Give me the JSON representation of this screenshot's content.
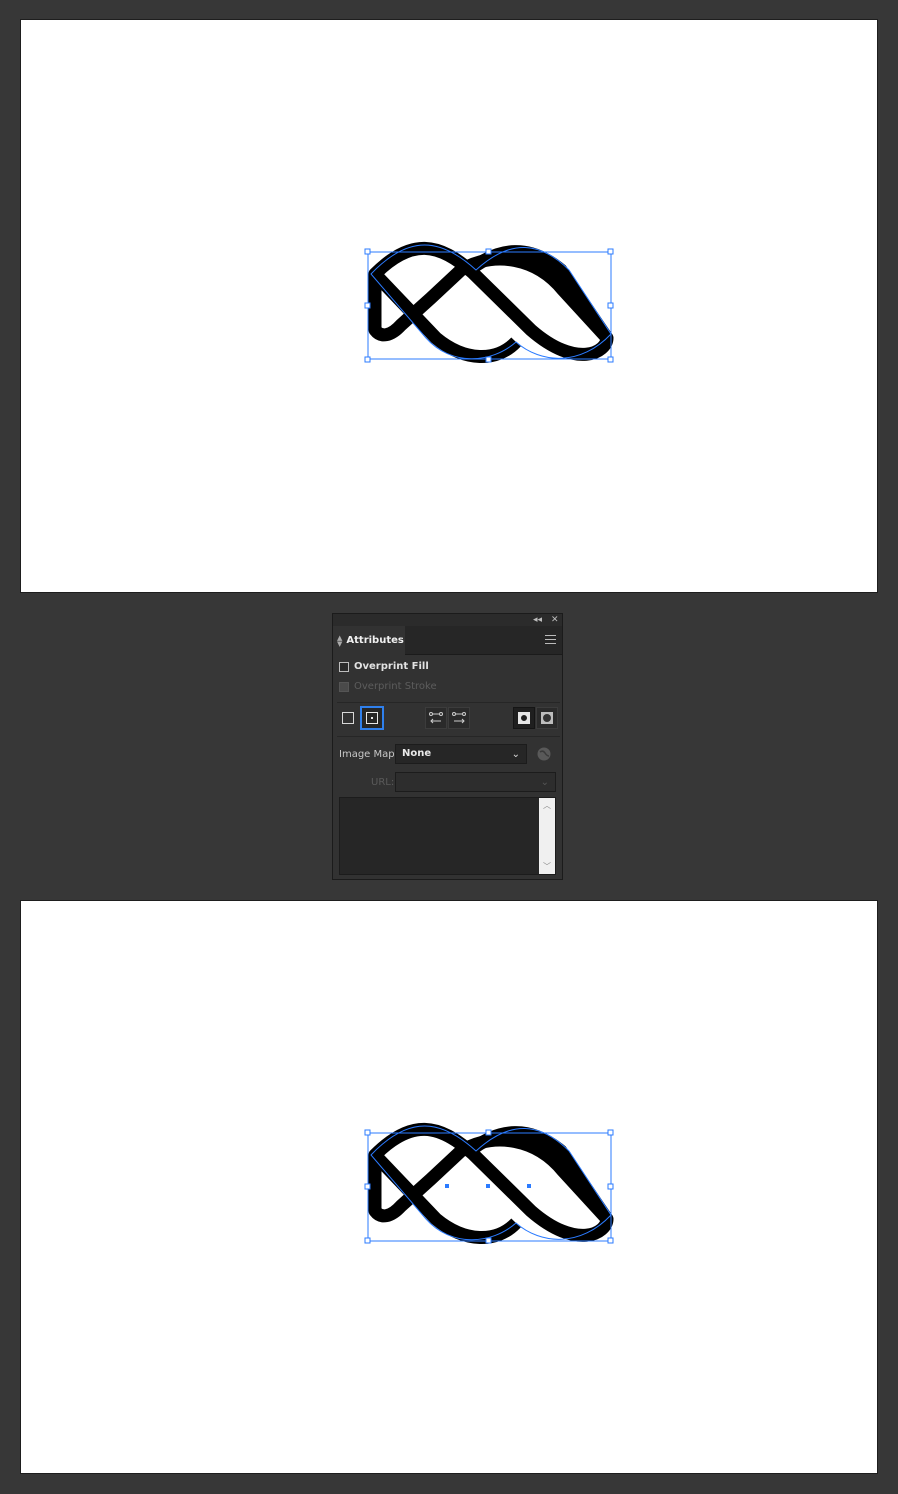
{
  "panel": {
    "tab_label": "Attributes",
    "collapse_glyph": "◂◂",
    "close_glyph": "✕",
    "overprint_fill_label": "Overprint Fill",
    "overprint_stroke_label": "Overprint Stroke",
    "overprint_fill_checked": false,
    "overprint_stroke_checked": false,
    "image_map_label": "Image Map:",
    "image_map_value": "None",
    "url_label": "URL:",
    "url_value": "",
    "chevron": "⌄",
    "scroll_up": "︿",
    "scroll_down": "﹀"
  },
  "icons": {
    "dont-show-center": "square-icon",
    "show-center": "square-dot-icon",
    "reverse-path-left": "reverse-path-left-icon",
    "reverse-path-right": "reverse-path-right-icon",
    "nonzero-winding": "nonzero-winding-icon",
    "even-odd": "even-odd-icon",
    "globe": "globe-icon"
  },
  "colors": {
    "selection": "#2b7bff",
    "accent_border": "#2f80ed",
    "ui_background": "#373737",
    "panel_background": "#323232"
  }
}
